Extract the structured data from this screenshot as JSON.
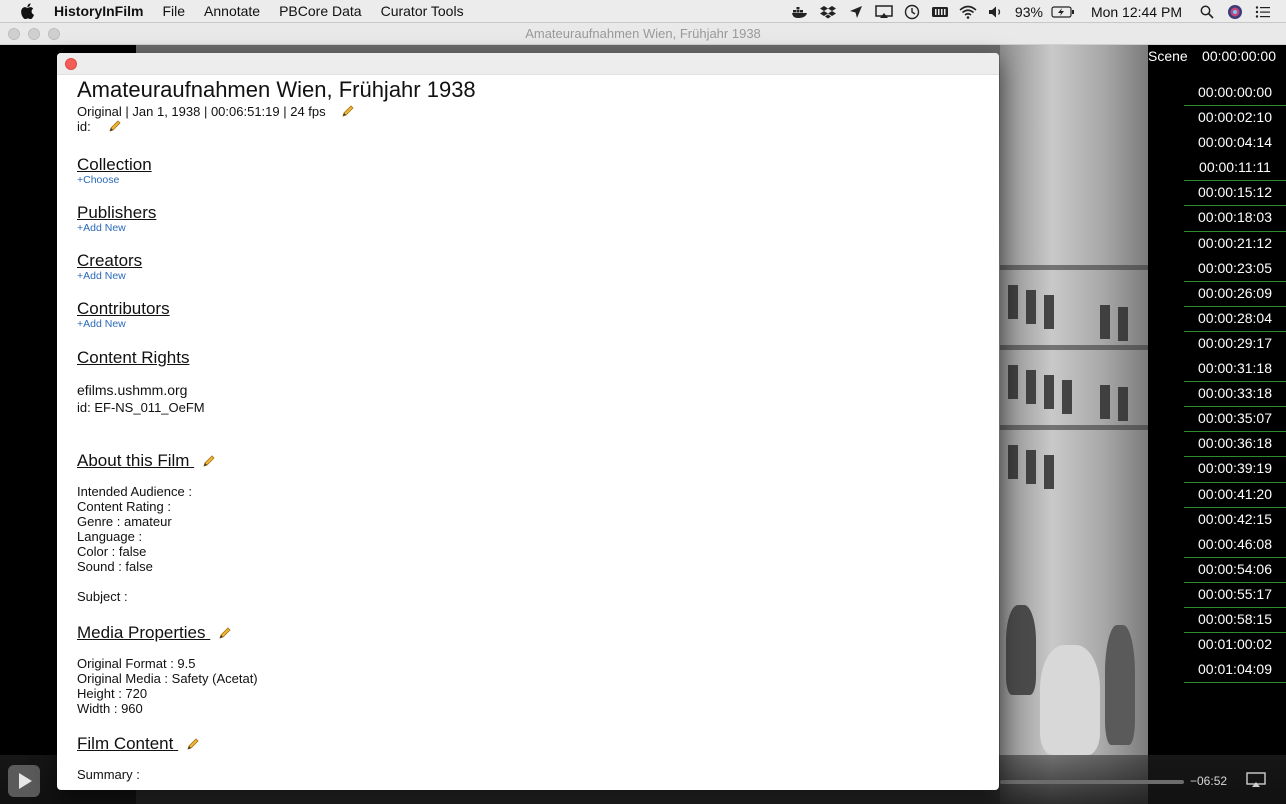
{
  "menubar": {
    "app_name": "HistoryInFilm",
    "items": [
      "File",
      "Annotate",
      "PBCore Data",
      "Curator Tools"
    ],
    "battery": "93%",
    "clock": "Mon 12:44 PM"
  },
  "window": {
    "title": "Amateuraufnahmen Wien, Frühjahr 1938"
  },
  "scene_panel": {
    "label": "Scene",
    "current_time": "00:00:00:00",
    "scenes": [
      "00:00:00:00",
      "00:00:02:10",
      "00:00:04:14",
      "00:00:11:11",
      "00:00:15:12",
      "00:00:18:03",
      "00:00:21:12",
      "00:00:23:05",
      "00:00:26:09",
      "00:00:28:04",
      "00:00:29:17",
      "00:00:31:18",
      "00:00:33:18",
      "00:00:35:07",
      "00:00:36:18",
      "00:00:39:19",
      "00:00:41:20",
      "00:00:42:15",
      "00:00:46:08",
      "00:00:54:06",
      "00:00:55:17",
      "00:00:58:15",
      "00:01:00:02",
      "00:01:04:09"
    ]
  },
  "controls": {
    "remaining": "−06:52"
  },
  "film": {
    "title": "Amateuraufnahmen Wien, Frühjahr 1938",
    "summary_line": "Original | Jan 1, 1938 | 00:06:51:19 | 24 fps",
    "id_label": "id:",
    "sections": {
      "collection": {
        "heading": "Collection",
        "link": "+Choose"
      },
      "publishers": {
        "heading": "Publishers",
        "link": "+Add New"
      },
      "creators": {
        "heading": "Creators",
        "link": "+Add New"
      },
      "contributors": {
        "heading": "Contributors",
        "link": "+Add New"
      },
      "content_rights": {
        "heading": "Content Rights",
        "source": "efilms.ushmm.org",
        "id": "id: EF-NS_011_OeFM"
      },
      "about": {
        "heading": "About this Film",
        "lines": [
          "Intended Audience :",
          "Content Rating :",
          "Genre : amateur",
          "Language :",
          "Color : false",
          "Sound : false"
        ],
        "subject": "Subject :"
      },
      "media": {
        "heading": "Media Properties",
        "lines": [
          "Original Format : 9.5",
          "Original Media : Safety (Acetat)",
          "Height : 720",
          "Width : 960"
        ]
      },
      "film_content": {
        "heading": "Film Content",
        "summary": "Summary :"
      }
    }
  }
}
